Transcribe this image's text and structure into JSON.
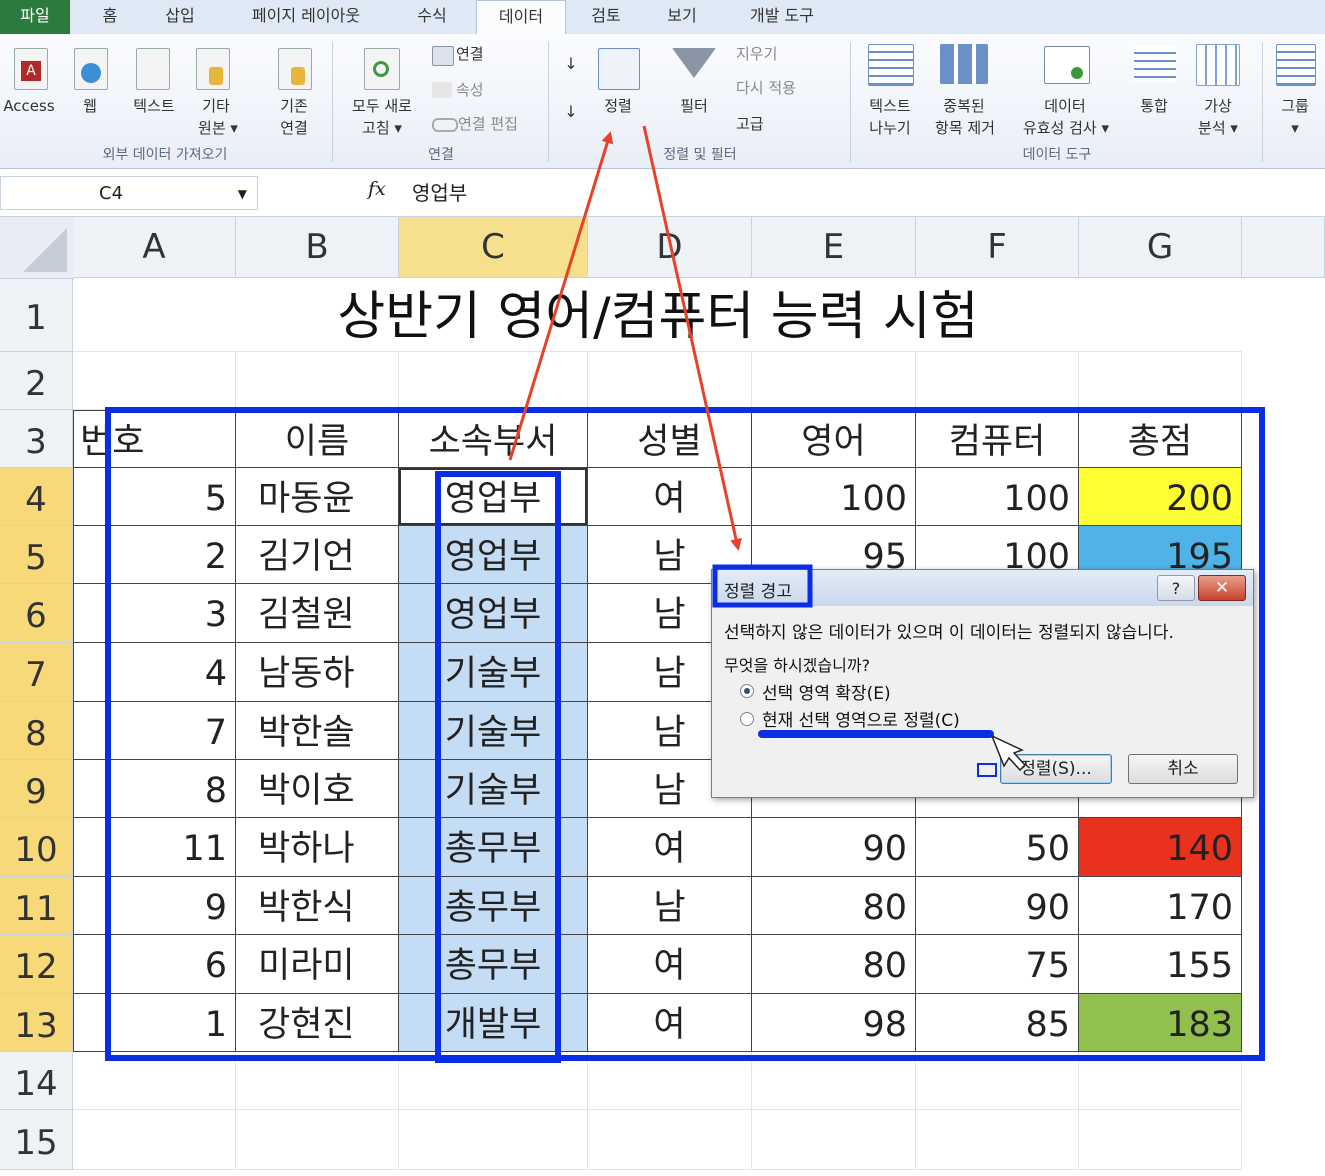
{
  "tabs": [
    "파일",
    "홈",
    "삽입",
    "페이지 레이아웃",
    "수식",
    "데이터",
    "검토",
    "보기",
    "개발 도구"
  ],
  "ribbon": {
    "access": "Access",
    "web": "웹",
    "text": "텍스트",
    "other_line1": "기타",
    "other_line2": "원본 ▾",
    "existing_line1": "기존",
    "existing_line2": "연결",
    "refresh_line1": "모두 새로",
    "refresh_line2": "고침 ▾",
    "connections": "연결",
    "properties": "속성",
    "edit_links": "연결 편집",
    "sort": "정렬",
    "filter": "필터",
    "clear": "지우기",
    "reapply": "다시 적용",
    "advanced": "고급",
    "text_to_columns_line1": "텍스트",
    "text_to_columns_line2": "나누기",
    "remove_dup_line1": "중복된",
    "remove_dup_line2": "항목 제거",
    "validation_line1": "데이터",
    "validation_line2": "유효성 검사 ▾",
    "consolidate": "통합",
    "whatif_line1": "가상",
    "whatif_line2": "분석 ▾",
    "group": "그룹",
    "group_dd": "▾",
    "group_external": "외부 데이터 가져오기",
    "group_connections": "연결",
    "group_sort_filter": "정렬 및 필터",
    "group_data_tools": "데이터 도구"
  },
  "formula_bar": {
    "name_box": "C4",
    "fx": "fx",
    "value": "영업부"
  },
  "columns": [
    "A",
    "B",
    "C",
    "D",
    "E",
    "F",
    "G"
  ],
  "rows": [
    "1",
    "2",
    "3",
    "4",
    "5",
    "6",
    "7",
    "8",
    "9",
    "10",
    "11",
    "12",
    "13",
    "14",
    "15"
  ],
  "sheet": {
    "title": "상반기 영어/컴퓨터 능력 시험",
    "headers": [
      "번호",
      "이름",
      "소속부서",
      "성별",
      "영어",
      "컴퓨터",
      "총점"
    ],
    "data": [
      [
        "5",
        "마동윤",
        "영업부",
        "여",
        "100",
        "100",
        "200"
      ],
      [
        "2",
        "김기언",
        "영업부",
        "남",
        "95",
        "100",
        "195"
      ],
      [
        "3",
        "김철원",
        "영업부",
        "남",
        "",
        "",
        ""
      ],
      [
        "4",
        "남동하",
        "기술부",
        "남",
        "",
        "",
        ""
      ],
      [
        "7",
        "박한솔",
        "기술부",
        "남",
        "",
        "",
        ""
      ],
      [
        "8",
        "박이호",
        "기술부",
        "남",
        "",
        "",
        ""
      ],
      [
        "11",
        "박하나",
        "총무부",
        "여",
        "90",
        "50",
        "140"
      ],
      [
        "9",
        "박한식",
        "총무부",
        "남",
        "80",
        "90",
        "170"
      ],
      [
        "6",
        "미라미",
        "총무부",
        "여",
        "80",
        "75",
        "155"
      ],
      [
        "1",
        "강현진",
        "개발부",
        "여",
        "98",
        "85",
        "183"
      ]
    ],
    "total_colors": [
      "#ffff33",
      "#4fb3e8",
      "",
      "",
      "",
      "",
      "#e8321e",
      "",
      "",
      "#92c04f"
    ]
  },
  "dialog": {
    "title": "정렬 경고",
    "help": "?",
    "close": "✕",
    "message": "선택하지 않은 데이터가 있으며 이 데이터는 정렬되지 않습니다.",
    "question": "무엇을 하시겠습니까?",
    "option1": "선택 영역 확장(E)",
    "option2": "현재 선택 영역으로 정렬(C)",
    "sort_button": "정렬(S)...",
    "cancel_button": "취소"
  },
  "colors": {
    "annotation_blue": "#0a2ee8",
    "annotation_red": "#e8412a",
    "selection": "#c5dcf5"
  }
}
